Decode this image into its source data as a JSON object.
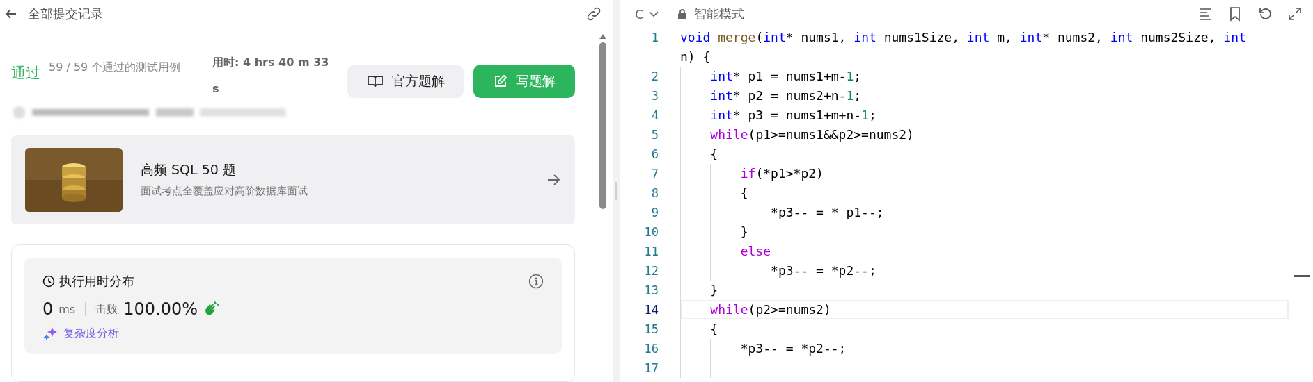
{
  "left_panel": {
    "header": {
      "title": "全部提交记录"
    },
    "result": {
      "status": "通过",
      "passed": "59 / 59 个通过的测试用例",
      "runtime": "用时: 4 hrs 40 m 33 s"
    },
    "buttons": [
      {
        "label": "官方题解",
        "kind": "secondary"
      },
      {
        "label": "写题解",
        "kind": "primary"
      }
    ],
    "promo": {
      "title": "高频 SQL 50 题",
      "subtitle": "面试考点全覆盖应对高阶数据库面试"
    },
    "runtime_card": {
      "title": "执行用时分布",
      "value": "0",
      "unit": "ms",
      "beats_label": "击败",
      "beats_value": "100.00%",
      "analysis_link": "复杂度分析"
    }
  },
  "editor": {
    "language": "C",
    "mode": "智能模式",
    "lines": [
      {
        "num": "1",
        "current": false,
        "tokens": [
          {
            "t": "void",
            "kind": "kw"
          },
          {
            "t": " merge",
            "kind": "fn"
          },
          {
            "t": "(",
            "kind": "plain"
          },
          {
            "t": "int",
            "kind": "kw"
          },
          {
            "t": "* nums1, ",
            "kind": "plain"
          },
          {
            "t": "int",
            "kind": "kw"
          },
          {
            "t": " nums1Size, ",
            "kind": "plain"
          },
          {
            "t": "int",
            "kind": "kw"
          },
          {
            "t": " m, ",
            "kind": "plain"
          },
          {
            "t": "int",
            "kind": "kw"
          },
          {
            "t": "* nums2, ",
            "kind": "plain"
          },
          {
            "t": "int",
            "kind": "kw"
          },
          {
            "t": " nums2Size, ",
            "kind": "plain"
          },
          {
            "t": "int",
            "kind": "kw"
          }
        ],
        "wrapped": [
          {
            "t": "n) {",
            "kind": "plain"
          }
        ]
      },
      {
        "num": "2",
        "current": false,
        "tokens": [
          {
            "t": "    int",
            "kind": "kw"
          },
          {
            "t": "* p1 = nums1+m-",
            "kind": "plain"
          },
          {
            "t": "1",
            "kind": "num"
          },
          {
            "t": ";",
            "kind": "plain"
          }
        ]
      },
      {
        "num": "3",
        "current": false,
        "tokens": [
          {
            "t": "    int",
            "kind": "kw"
          },
          {
            "t": "* p2 = nums2+n-",
            "kind": "plain"
          },
          {
            "t": "1",
            "kind": "num"
          },
          {
            "t": ";",
            "kind": "plain"
          }
        ]
      },
      {
        "num": "4",
        "current": false,
        "tokens": [
          {
            "t": "    int",
            "kind": "kw"
          },
          {
            "t": "* p3 = nums1+m+n-",
            "kind": "plain"
          },
          {
            "t": "1",
            "kind": "num"
          },
          {
            "t": ";",
            "kind": "plain"
          }
        ]
      },
      {
        "num": "5",
        "current": false,
        "tokens": [
          {
            "t": "    while",
            "kind": "ctl"
          },
          {
            "t": "(p1>=nums1&&p2>=nums2)",
            "kind": "plain"
          }
        ]
      },
      {
        "num": "6",
        "current": false,
        "tokens": [
          {
            "t": "    {",
            "kind": "plain"
          }
        ]
      },
      {
        "num": "7",
        "current": false,
        "tokens": [
          {
            "t": "        if",
            "kind": "ctl"
          },
          {
            "t": "(*p1>*p2)",
            "kind": "plain"
          }
        ]
      },
      {
        "num": "8",
        "current": false,
        "tokens": [
          {
            "t": "        {",
            "kind": "plain"
          }
        ]
      },
      {
        "num": "9",
        "current": false,
        "tokens": [
          {
            "t": "            *p3-- = * p1--;",
            "kind": "plain"
          }
        ]
      },
      {
        "num": "10",
        "current": false,
        "tokens": [
          {
            "t": "        }",
            "kind": "plain"
          }
        ]
      },
      {
        "num": "11",
        "current": false,
        "tokens": [
          {
            "t": "        else",
            "kind": "ctl"
          }
        ]
      },
      {
        "num": "12",
        "current": false,
        "tokens": [
          {
            "t": "            *p3-- = *p2--;",
            "kind": "plain"
          }
        ]
      },
      {
        "num": "13",
        "current": false,
        "tokens": [
          {
            "t": "    }",
            "kind": "plain"
          }
        ]
      },
      {
        "num": "14",
        "current": true,
        "tokens": [
          {
            "t": "    while",
            "kind": "ctl"
          },
          {
            "t": "(p2>=nums2)",
            "kind": "plain"
          }
        ]
      },
      {
        "num": "15",
        "current": false,
        "tokens": [
          {
            "t": "    {",
            "kind": "plain"
          }
        ]
      },
      {
        "num": "16",
        "current": false,
        "tokens": [
          {
            "t": "        *p3-- = *p2--;",
            "kind": "plain"
          }
        ]
      },
      {
        "num": "17",
        "current": false
      }
    ]
  }
}
